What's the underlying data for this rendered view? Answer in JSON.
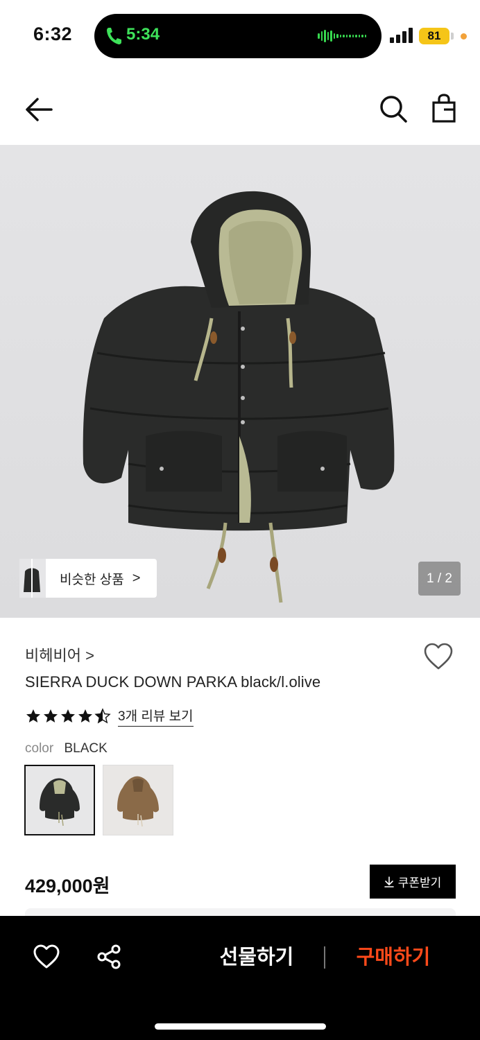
{
  "status_bar": {
    "time": "6:32",
    "call_time": "5:34",
    "battery": "81"
  },
  "product": {
    "brand": "비헤비어 >",
    "title": "SIERRA DUCK DOWN PARKA black/l.olive",
    "rating": 4.5,
    "review_link": "3개 리뷰 보기",
    "color_label": "color",
    "color_value": "BLACK",
    "color_options": [
      "black",
      "brown"
    ],
    "price": "429,000원",
    "coupon_label": "쿠폰받기"
  },
  "gallery": {
    "similar_label": "비슷한 상품",
    "similar_chevron": ">",
    "counter": "1 / 2"
  },
  "actions": {
    "gift_label": "선물하기",
    "buy_label": "구매하기"
  },
  "colors": {
    "accent": "#ff4a1a",
    "call_green": "#3ee25a",
    "battery": "#f5c518"
  },
  "icons": [
    "back-icon",
    "search-icon",
    "shopping-bag-icon",
    "heart-icon",
    "star-icon",
    "download-icon",
    "share-icon"
  ]
}
